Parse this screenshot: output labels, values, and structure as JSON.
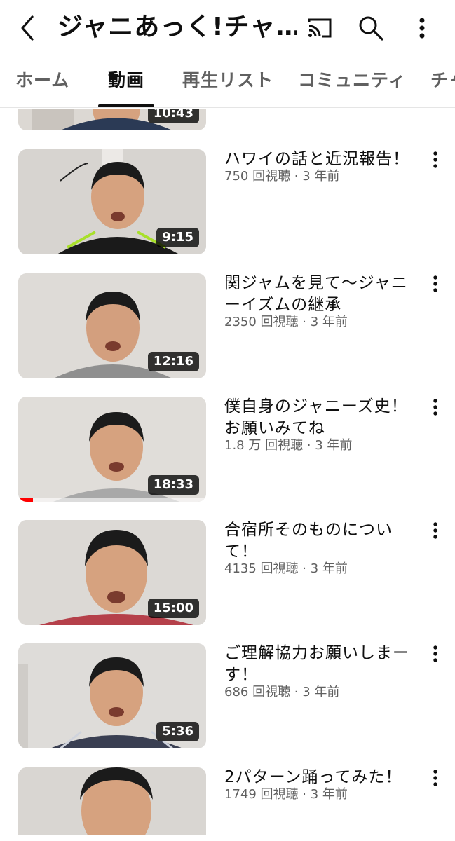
{
  "header": {
    "channel_title": "ジャニあっく!チャ…",
    "icons": [
      "back-icon",
      "cast-icon",
      "search-icon",
      "more-vert-icon"
    ]
  },
  "tabs": [
    {
      "label": "ホーム",
      "active": false
    },
    {
      "label": "動画",
      "active": true
    },
    {
      "label": "再生リスト",
      "active": false
    },
    {
      "label": "コミュニティ",
      "active": false
    },
    {
      "label": "チャ",
      "active": false
    }
  ],
  "videos": [
    {
      "duration": "10:43",
      "title": "",
      "meta": "",
      "shirt": "#2b3a55"
    },
    {
      "duration": "9:15",
      "title": "ハワイの話と近況報告！",
      "meta": "750 回視聴 · 3 年前",
      "shirt": "#1a1a1a"
    },
    {
      "duration": "12:16",
      "title": "関ジャムを見て〜ジャニーイズムの継承",
      "meta": "2350 回視聴 · 3 年前",
      "shirt": "#8f8f8f"
    },
    {
      "duration": "18:33",
      "title": "僕自身のジャニーズ史！お願いみてね",
      "meta": "1.8 万 回視聴 · 3 年前",
      "shirt": "#a8a8a8",
      "progress": 0.08
    },
    {
      "duration": "15:00",
      "title": "合宿所そのものについて！",
      "meta": "4135 回視聴 · 3 年前",
      "shirt": "#b5404a"
    },
    {
      "duration": "5:36",
      "title": "ご理解協力お願いしまーす！",
      "meta": "686 回視聴 · 3 年前",
      "shirt": "#3a3f52"
    },
    {
      "duration": "",
      "title": "2パターン踊ってみた！",
      "meta": "1749 回視聴 · 3 年前",
      "shirt": "#e8492a"
    }
  ],
  "colors": {
    "progress": "#ff0000",
    "skin": "#d6a27f",
    "hair": "#1b1b1b"
  }
}
